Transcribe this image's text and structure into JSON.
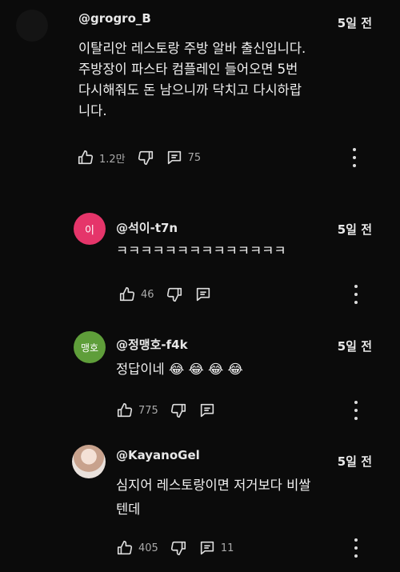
{
  "comments": [
    {
      "handle": "@grogro_B",
      "time": "5일 전",
      "text": "이탈리안 레스토랑 주방 알바 출신입니다.\n주방장이 파스타 컴플레인 들어오면 5번\n다시해줘도 돈 남으니까 닥치고 다시하랍\n니다.",
      "likes": "1.2만",
      "replies": "75",
      "avatar_color": "#141414"
    },
    {
      "handle": "@석이-t7n",
      "time": "5일 전",
      "text": "ㅋㅋㅋㅋㅋㅋㅋㅋㅋㅋㅋㅋㅋㅋ",
      "likes": "46",
      "avatar_label": "이",
      "avatar_color": "#e5356a"
    },
    {
      "handle": "@정맹호-f4k",
      "time": "5일 전",
      "text": "정답이네 😂 😂 😂 😂",
      "likes": "775",
      "avatar_label": "맹호",
      "avatar_color": "#5f9e3a"
    },
    {
      "handle": "@KayanoGel",
      "time": "5일 전",
      "text": "심지어 레스토랑이면 저거보다 비쌀\n텐데",
      "likes": "405",
      "replies": "11",
      "avatar_color": "#d9c2b6"
    }
  ]
}
